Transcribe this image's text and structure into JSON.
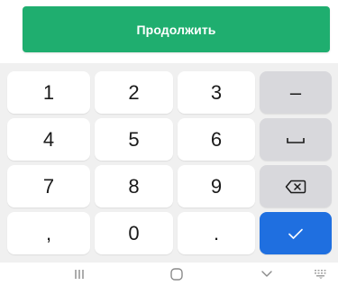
{
  "continue_button": {
    "label": "Продолжить"
  },
  "keys": {
    "one": "1",
    "two": "2",
    "three": "3",
    "four": "4",
    "five": "5",
    "six": "6",
    "seven": "7",
    "eight": "8",
    "nine": "9",
    "comma": ",",
    "zero": "0",
    "dot": ".",
    "minus": "–"
  },
  "icons": {
    "space": "space-icon",
    "backspace": "backspace-icon",
    "done": "checkmark-icon",
    "nav_recents": "recent-apps-icon",
    "nav_home": "home-icon",
    "nav_back": "back-chevron-icon",
    "nav_keyboard": "keyboard-switch-icon"
  },
  "colors": {
    "continue_bg": "#1fae6f",
    "done_bg": "#1f6fe0",
    "function_key_bg": "#d8d8dc",
    "keyboard_bg": "#f0f0f0"
  }
}
